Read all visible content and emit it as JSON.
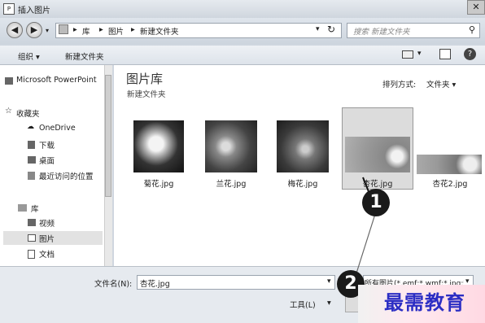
{
  "window": {
    "title": "插入图片",
    "close_glyph": "✕"
  },
  "address": {
    "crumbs": [
      "库",
      "图片",
      "新建文件夹"
    ],
    "sep": "▸"
  },
  "search": {
    "placeholder": "搜索 新建文件夹"
  },
  "toolbar": {
    "organize": "组织 ▾",
    "new_folder": "新建文件夹"
  },
  "sidebar": {
    "items": [
      {
        "label": "Microsoft PowerPoint"
      },
      {
        "label": "收藏夹"
      },
      {
        "label": "OneDrive"
      },
      {
        "label": "下载"
      },
      {
        "label": "桌面"
      },
      {
        "label": "最近访问的位置"
      },
      {
        "label": "库"
      },
      {
        "label": "视频"
      },
      {
        "label": "图片"
      },
      {
        "label": "文档"
      }
    ]
  },
  "main": {
    "title": "图片库",
    "subtitle": "新建文件夹",
    "arrange_label": "排列方式:",
    "arrange_value": "文件夹 ▾",
    "files": [
      {
        "name": "菊花.jpg"
      },
      {
        "name": "兰花.jpg"
      },
      {
        "name": "梅花.jpg"
      },
      {
        "name": "杏花.jpg",
        "selected": true
      },
      {
        "name": "杏花2.jpg"
      }
    ]
  },
  "footer": {
    "filename_label": "文件名(N):",
    "filename_value": "杏花.jpg",
    "filetype_value": "所有图片(*.emf;*.wmf;*.jpg;*.jp",
    "tools_label": "工具(L)",
    "tools_arrow": "▾"
  },
  "callouts": [
    "1",
    "2"
  ],
  "watermark": "最需教育"
}
